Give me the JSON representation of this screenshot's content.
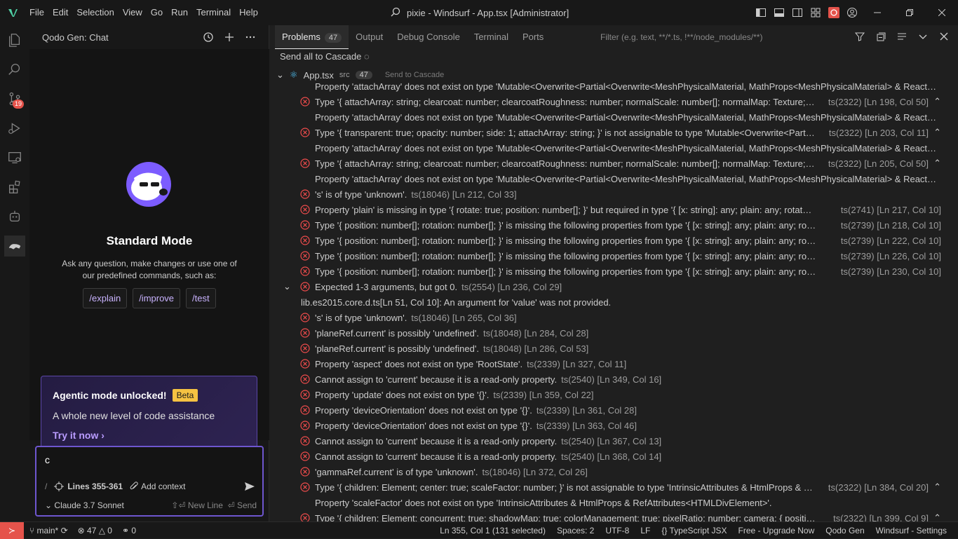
{
  "menu": [
    "File",
    "Edit",
    "Selection",
    "View",
    "Go",
    "Run",
    "Terminal",
    "Help"
  ],
  "window_title": "pixie - Windsurf - App.tsx [Administrator]",
  "activity_badge": "19",
  "sidebar": {
    "title": "Qodo Gen: Chat",
    "mode_title": "Standard Mode",
    "mode_desc": "Ask any question, make changes or use one of our predefined commands, such as:",
    "commands": [
      "/explain",
      "/improve",
      "/test"
    ],
    "agentic_title": "Agentic mode unlocked!",
    "agentic_badge": "Beta",
    "agentic_sub": "A whole new level of code assistance",
    "agentic_link": "Try it now",
    "input_value": "c",
    "slash": "/",
    "lines_label": "Lines 355-361",
    "add_context": "Add context",
    "model": "Claude 3.7 Sonnet",
    "newline": "⇧⏎ New Line",
    "send": "⏎ Send"
  },
  "panel": {
    "tabs": [
      "Problems",
      "Output",
      "Debug Console",
      "Terminal",
      "Ports"
    ],
    "problems_count": "47",
    "filter_placeholder": "Filter (e.g. text, **/*.ts, !**/node_modules/**)",
    "send_all": "Send all to Cascade",
    "file_name": "App.tsx",
    "file_dir": "src",
    "file_count": "47",
    "file_send": "Send to Cascade"
  },
  "problems": [
    {
      "kind": "sub",
      "text": "Property 'attachArray' does not exist on type 'Mutable<Overwrite<Partial<Overwrite<MeshPhysicalMaterial, MathProps<MeshPhysicalMaterial> & ReactPro..."
    },
    {
      "kind": "err",
      "text": "Type '{ attachArray: string; clearcoat: number; clearcoatRoughness: number; normalScale: number[]; normalMap: Texture; rough...",
      "meta": "ts(2322)  [Ln 198, Col 50]",
      "chev": "⌃"
    },
    {
      "kind": "sub",
      "text": "Property 'attachArray' does not exist on type 'Mutable<Overwrite<Partial<Overwrite<MeshPhysicalMaterial, MathProps<MeshPhysicalMaterial> & ReactPro..."
    },
    {
      "kind": "err",
      "text": "Type '{ transparent: true; opacity: number; side: 1; attachArray: string; }' is not assignable to type 'Mutable<Overwrite<Partial<...",
      "meta": "ts(2322)  [Ln 203, Col 11]",
      "chev": "⌃"
    },
    {
      "kind": "sub",
      "text": "Property 'attachArray' does not exist on type 'Mutable<Overwrite<Partial<Overwrite<MeshPhysicalMaterial, MathProps<MeshPhysicalMaterial> & ReactPro..."
    },
    {
      "kind": "err",
      "text": "Type '{ attachArray: string; clearcoat: number; clearcoatRoughness: number; normalScale: number[]; normalMap: Texture; rough...",
      "meta": "ts(2322)  [Ln 205, Col 50]",
      "chev": "⌃"
    },
    {
      "kind": "sub",
      "text": "Property 'attachArray' does not exist on type 'Mutable<Overwrite<Partial<Overwrite<MeshPhysicalMaterial, MathProps<MeshPhysicalMaterial> & ReactPro..."
    },
    {
      "kind": "inline",
      "text": "'s' is of type 'unknown'.",
      "meta": "ts(18046)  [Ln 212, Col 33]"
    },
    {
      "kind": "err",
      "text": "Property 'plain' is missing in type '{ rotate: true; position: number[]; }' but required in type '{ [x: string]: any; plain: any; rotate: any; r...",
      "meta": "ts(2741)  [Ln 217, Col 10]"
    },
    {
      "kind": "err",
      "text": "Type '{ position: number[]; rotation: number[]; }' is missing the following properties from type '{ [x: string]: any; plain: any; rotate: a...",
      "meta": "ts(2739)  [Ln 218, Col 10]"
    },
    {
      "kind": "err",
      "text": "Type '{ position: number[]; rotation: number[]; }' is missing the following properties from type '{ [x: string]: any; plain: any; rotate: a...",
      "meta": "ts(2739)  [Ln 222, Col 10]"
    },
    {
      "kind": "err",
      "text": "Type '{ position: number[]; rotation: number[]; }' is missing the following properties from type '{ [x: string]: any; plain: any; rotate: a...",
      "meta": "ts(2739)  [Ln 226, Col 10]"
    },
    {
      "kind": "err",
      "text": "Type '{ position: number[]; rotation: number[]; }' is missing the following properties from type '{ [x: string]: any; plain: any; rotate: a...",
      "meta": "ts(2739)  [Ln 230, Col 10]"
    },
    {
      "kind": "inline",
      "toggle": "⌄",
      "text": "Expected 1-3 arguments, but got 0.",
      "meta": "ts(2554)  [Ln 236, Col 29]"
    },
    {
      "kind": "sub2",
      "text": "lib.es2015.core.d.ts[Ln 51, Col 10]: An argument for 'value' was not provided."
    },
    {
      "kind": "inline",
      "text": "'s' is of type 'unknown'.",
      "meta": "ts(18046)  [Ln 265, Col 36]"
    },
    {
      "kind": "inline",
      "text": "'planeRef.current' is possibly 'undefined'.",
      "meta": "ts(18048)  [Ln 284, Col 28]"
    },
    {
      "kind": "inline",
      "text": "'planeRef.current' is possibly 'undefined'.",
      "meta": "ts(18048)  [Ln 286, Col 53]"
    },
    {
      "kind": "inline",
      "text": "Property 'aspect' does not exist on type 'RootState'.",
      "meta": "ts(2339)  [Ln 327, Col 11]"
    },
    {
      "kind": "inline",
      "text": "Cannot assign to 'current' because it is a read-only property.",
      "meta": "ts(2540)  [Ln 349, Col 16]"
    },
    {
      "kind": "inline",
      "text": "Property 'update' does not exist on type '{}'.",
      "meta": "ts(2339)  [Ln 359, Col 22]"
    },
    {
      "kind": "inline",
      "text": "Property 'deviceOrientation' does not exist on type '{}'.",
      "meta": "ts(2339)  [Ln 361, Col 28]"
    },
    {
      "kind": "inline",
      "text": "Property 'deviceOrientation' does not exist on type '{}'.",
      "meta": "ts(2339)  [Ln 363, Col 46]"
    },
    {
      "kind": "inline",
      "text": "Cannot assign to 'current' because it is a read-only property.",
      "meta": "ts(2540)  [Ln 367, Col 13]"
    },
    {
      "kind": "inline",
      "text": "Cannot assign to 'current' because it is a read-only property.",
      "meta": "ts(2540)  [Ln 368, Col 14]"
    },
    {
      "kind": "inline",
      "text": "'gammaRef.current' is of type 'unknown'.",
      "meta": "ts(18046)  [Ln 372, Col 26]"
    },
    {
      "kind": "err",
      "text": "Type '{ children: Element; center: true; scaleFactor: number; }' is not assignable to type 'IntrinsicAttributes & HtmlProps & RefAt...",
      "meta": "ts(2322)  [Ln 384, Col 20]",
      "chev": "⌃"
    },
    {
      "kind": "sub",
      "text": "Property 'scaleFactor' does not exist on type 'IntrinsicAttributes & HtmlProps & RefAttributes<HTMLDivElement>'."
    },
    {
      "kind": "err",
      "text": "Type '{ children: Element; concurrent: true; shadowMap: true; colorManagement: true; pixelRatio: number; camera: { position: [nu...",
      "meta": "ts(2322)  [Ln 399, Col 9]",
      "chev": "⌃"
    }
  ],
  "status": {
    "branch": "main*",
    "errors": "47",
    "warnings": "0",
    "ports": "0",
    "position": "Ln 355, Col 1 (131 selected)",
    "spaces": "Spaces: 2",
    "encoding": "UTF-8",
    "eol": "LF",
    "language": "TypeScript JSX",
    "plan": "Free - Upgrade Now",
    "ext": "Qodo Gen",
    "settings": "Windsurf - Settings"
  },
  "colors": {
    "accent": "#6e56cf",
    "error": "#f14c4c",
    "badge": "#e5534b",
    "beta": "#f5c242"
  }
}
